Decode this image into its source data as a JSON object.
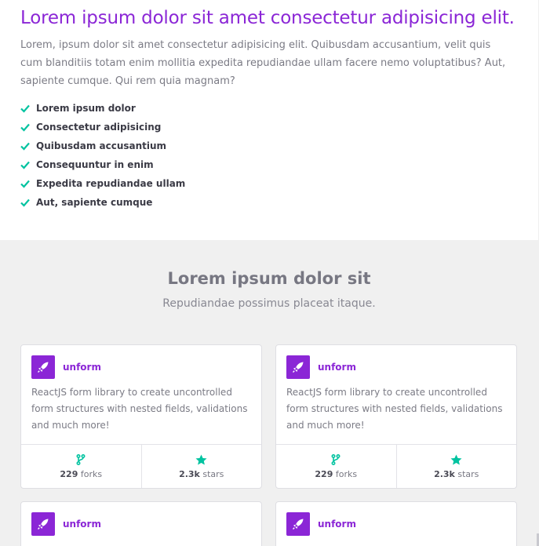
{
  "hero": {
    "title": "Lorem ipsum dolor sit amet consectetur adipisicing elit.",
    "description": "Lorem, ipsum dolor sit amet consectetur adipisicing elit. Quibusdam accusantium, velit quis cum blanditiis totam enim mollitia expedita repudiandae ullam facere nemo voluptatibus? Aut, sapiente cumque. Qui rem quia magnam?",
    "features": [
      "Lorem ipsum dolor",
      "Consectetur adipisicing",
      "Quibusdam accusantium",
      "Consequuntur in enim",
      "Expedita repudiandae ullam",
      "Aut, sapiente cumque"
    ],
    "check_icon": "check-icon"
  },
  "projects": {
    "title": "Lorem ipsum dolor sit",
    "subtitle": "Repudiandae possimus placeat itaque.",
    "cards": [
      {
        "name": "unform",
        "description": "ReactJS form library to create uncontrolled form structures with nested fields, validations and much more!",
        "forks": "229",
        "forks_label": "forks",
        "stars": "2.3k",
        "stars_label": "stars"
      },
      {
        "name": "unform",
        "description": "ReactJS form library to create uncontrolled form structures with nested fields, validations and much more!",
        "forks": "229",
        "forks_label": "forks",
        "stars": "2.3k",
        "stars_label": "stars"
      },
      {
        "name": "unform"
      },
      {
        "name": "unform"
      }
    ]
  },
  "colors": {
    "accent": "#8b26d6",
    "check": "#00c3a0",
    "background": "#f0f0f0"
  },
  "icons": {
    "logo": "rocket-icon",
    "forks": "git-fork-icon",
    "stars": "star-icon"
  }
}
